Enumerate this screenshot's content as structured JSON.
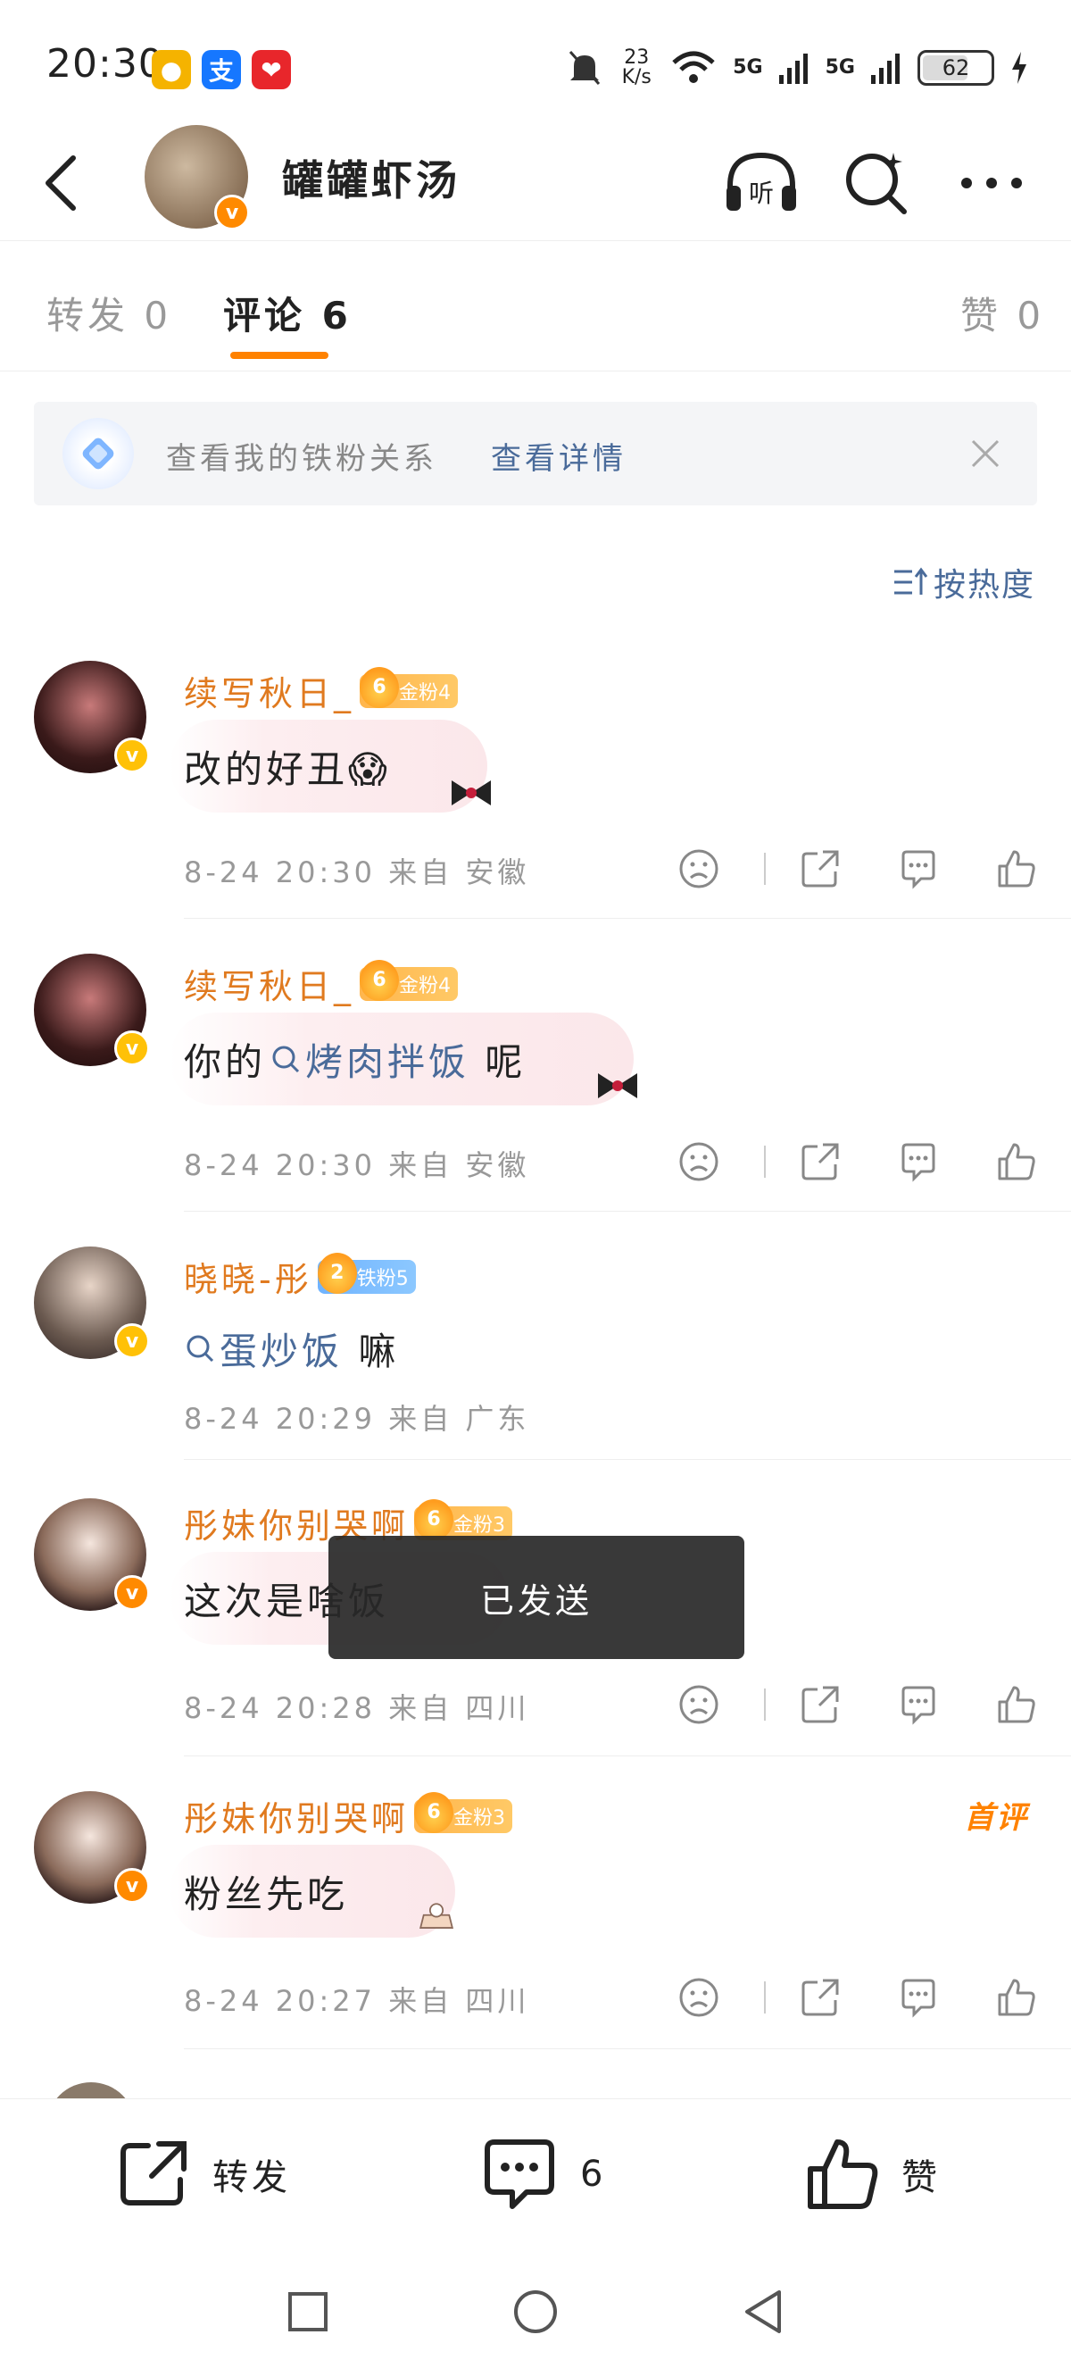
{
  "status_bar": {
    "time": "20:30",
    "net_speed": "23 K/s",
    "signal1": "5G",
    "signal2": "5G",
    "battery": "62"
  },
  "header": {
    "title": "罐罐虾汤",
    "listen_label": "听"
  },
  "tabs": [
    {
      "label": "转发 0"
    },
    {
      "label": "评论 6"
    },
    {
      "label": "赞 0"
    }
  ],
  "banner": {
    "text": "查看我的铁粉关系",
    "link": "查看详情"
  },
  "sort_label": "按热度",
  "comments": [
    {
      "name": "续写秋日_",
      "fan_badge": "金粉4",
      "crown_level": "6",
      "content": "改的好丑😱",
      "meta": "8-24 20:30 来自 安徽"
    },
    {
      "name": "续写秋日_",
      "fan_badge": "金粉4",
      "crown_level": "6",
      "content_prefix": "你的",
      "content_link": "烤肉拌饭",
      "content_suffix": " 呢",
      "meta": "8-24 20:30 来自 安徽"
    },
    {
      "name": "晓晓-彤",
      "fan_badge": "铁粉5",
      "crown_level": "2",
      "content_link": "蛋炒饭",
      "content_suffix": " 嘛",
      "meta": "8-24 20:29 来自 广东"
    },
    {
      "name": "彤妹你别哭啊",
      "fan_badge": "金粉3",
      "crown_level": "6",
      "content": "这次是啥饭",
      "meta": "8-24 20:28 来自 四川"
    },
    {
      "name": "彤妹你别哭啊",
      "fan_badge": "金粉3",
      "crown_level": "6",
      "content": "粉丝先吃",
      "meta": "8-24 20:27 来自 四川",
      "tag": "首评"
    }
  ],
  "toast": "已发送",
  "bottom_bar": {
    "repost": "转发",
    "comment_count": "6",
    "like": "赞"
  },
  "colors": {
    "accent": "#ff8200",
    "link": "#4a6b9a",
    "username": "#e07a1f"
  }
}
